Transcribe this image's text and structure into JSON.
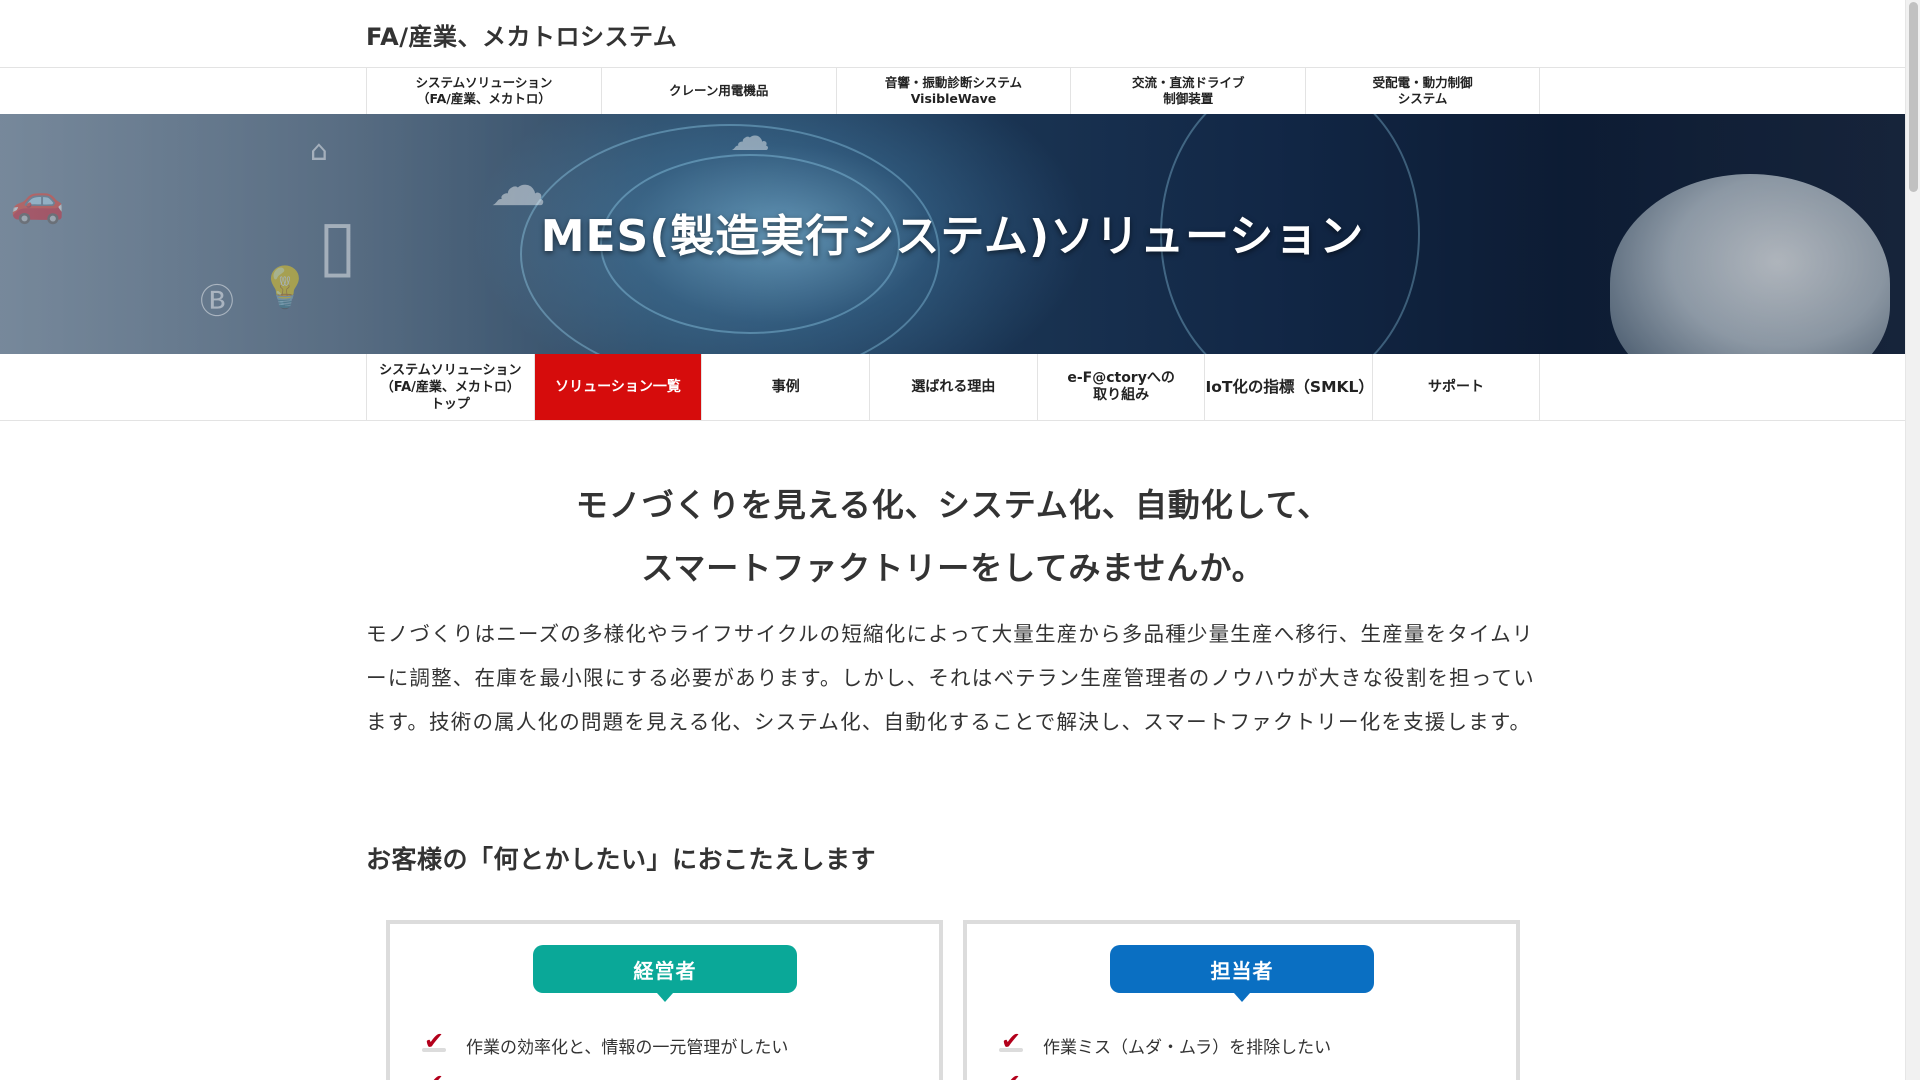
{
  "site": {
    "title": "FA/産業、メカトロシステム"
  },
  "global_nav": [
    {
      "label": "システムソリューション\n（FA/産業、メカトロ）"
    },
    {
      "label": "クレーン用電機品"
    },
    {
      "label": "音響・振動診断システム\nVisibleWave"
    },
    {
      "label": "交流・直流ドライブ\n制御装置"
    },
    {
      "label": "受配電・動力制御\nシステム"
    }
  ],
  "hero": {
    "title": "MES(製造実行システム)ソリューション"
  },
  "local_nav": [
    {
      "label": "システムソリューション\n（FA/産業、メカトロ）\nトップ",
      "active": false
    },
    {
      "label": "ソリューション一覧",
      "active": true
    },
    {
      "label": "事例",
      "active": false
    },
    {
      "label": "選ばれる理由",
      "active": false
    },
    {
      "label": "e-F@ctoryへの\n取り組み",
      "active": false
    },
    {
      "label": "IoT化の指標（SMKL）",
      "active": false
    },
    {
      "label": "サポート",
      "active": false
    }
  ],
  "lead": {
    "heading": "モノづくりを見える化、システム化、自動化して、\nスマートファクトリーをしてみませんか。",
    "text": "モノづくりはニーズの多様化やライフサイクルの短縮化によって大量生産から多品種少量生産へ移行、生産量をタイムリーに調整、在庫を最小限にする必要があります。しかし、それはベテラン生産管理者のノウハウが大きな役割を担っています。技術の属人化の問題を見える化、システム化、自動化することで解決し、スマートファクトリー化を支援します。"
  },
  "section": {
    "heading": "お客様の「何とかしたい」におこたえします"
  },
  "cards": [
    {
      "badge": "経営者",
      "color": "#0aa898",
      "items": [
        "作業の効率化と、情報の一元管理がしたい"
      ]
    },
    {
      "badge": "担当者",
      "color": "#0a6fc2",
      "items": [
        "作業ミス（ムダ・ムラ）を排除したい"
      ]
    }
  ],
  "colors": {
    "accent_red": "#d60c0c",
    "check_red": "#b3001b"
  },
  "icons": {
    "check": "checkmark-icon"
  }
}
